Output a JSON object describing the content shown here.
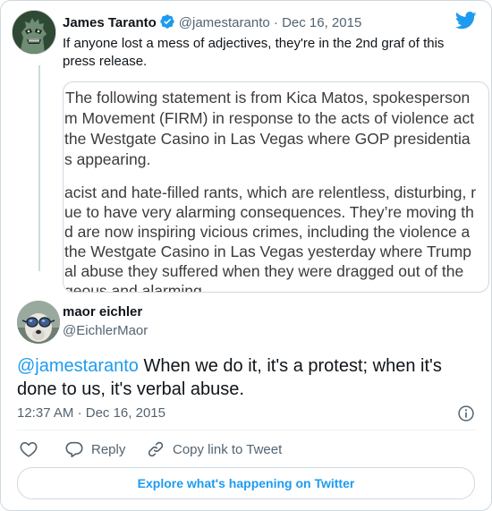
{
  "parent_tweet": {
    "author_name": "James Taranto",
    "handle": "@jamestaranto",
    "separator": "·",
    "date": "Dec 16, 2015",
    "text": "If anyone lost a mess of adjectives, they're in the 2nd graf of this press release.",
    "avatar_icon": "godzilla-avatar",
    "media_lines": [
      "The following statement is from Kica Matos, spokesperson",
      "m Movement (FIRM) in response to the acts of violence act",
      " the Westgate Casino in Las Vegas where GOP presidentia",
      "s appearing.",
      "",
      "acist and hate-filled rants, which are relentless, disturbing, r",
      "ue to have very alarming consequences. They’re moving th",
      "d are now inspiring vicious crimes, including the violence a",
      " the Westgate Casino in Las Vegas yesterday where Trump",
      "al abuse they suffered when they were dragged out of the",
      "geous and alarming."
    ]
  },
  "reply_tweet": {
    "author_name": "maor eichler",
    "handle": "@EichlerMaor",
    "mention": "@jamestaranto",
    "text": " When we do it, it's a protest; when it's done to us, it's verbal abuse.",
    "time": "12:37 AM",
    "separator": "·",
    "date": "Dec 16, 2015",
    "avatar_icon": "dog-with-goggles-avatar"
  },
  "actions": {
    "reply_label": "Reply",
    "copy_link_label": "Copy link to Tweet"
  },
  "explore_label": "Explore what's happening on Twitter",
  "colors": {
    "accent": "#1d9bf0",
    "text": "#0f1419",
    "secondary": "#536471",
    "border": "#cfd9de"
  }
}
